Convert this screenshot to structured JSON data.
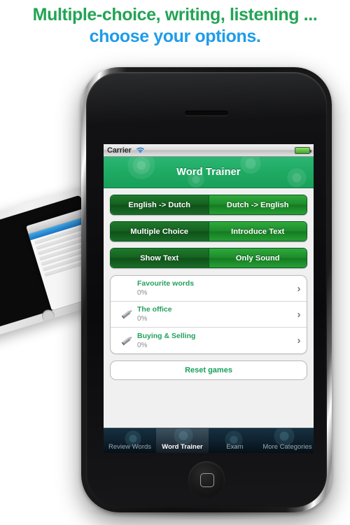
{
  "headline": {
    "line1": "Multiple-choice, writing, listening ...",
    "line2": "choose your options.",
    "color1": "#23a455",
    "color2": "#1e9de8"
  },
  "device": {
    "name": "iphone-3gs",
    "background_device": "ipad"
  },
  "status_bar": {
    "carrier": "Carrier",
    "wifi_icon": "wifi-icon",
    "battery_icon": "battery-full-icon"
  },
  "title_bar": {
    "title": "Word Trainer",
    "color": "#1faa63"
  },
  "segmented_controls": [
    {
      "name": "direction",
      "options": [
        {
          "label": "English -> Dutch",
          "selected": true
        },
        {
          "label": "Dutch -> English",
          "selected": false
        }
      ]
    },
    {
      "name": "mode",
      "options": [
        {
          "label": "Multiple Choice",
          "selected": true
        },
        {
          "label": "Introduce Text",
          "selected": false
        }
      ]
    },
    {
      "name": "presentation",
      "options": [
        {
          "label": "Show Text",
          "selected": true
        },
        {
          "label": "Only Sound",
          "selected": false
        }
      ]
    }
  ],
  "word_list": {
    "rows": [
      {
        "name": "Favourite words",
        "progress": "0%",
        "icon": "none",
        "chevron": "›"
      },
      {
        "name": "The office",
        "progress": "0%",
        "icon": "pencil-icon",
        "chevron": "›"
      },
      {
        "name": "Buying & Selling",
        "progress": "0%",
        "icon": "pencil-icon",
        "chevron": "›"
      }
    ]
  },
  "reset_button": {
    "label": "Reset games",
    "color": "#17a05a"
  },
  "tab_bar": {
    "tabs": [
      {
        "label": "Review Words",
        "active": false
      },
      {
        "label": "Word Trainer",
        "active": true
      },
      {
        "label": "Exam",
        "active": false
      },
      {
        "label": "More Categories",
        "active": false
      }
    ]
  }
}
